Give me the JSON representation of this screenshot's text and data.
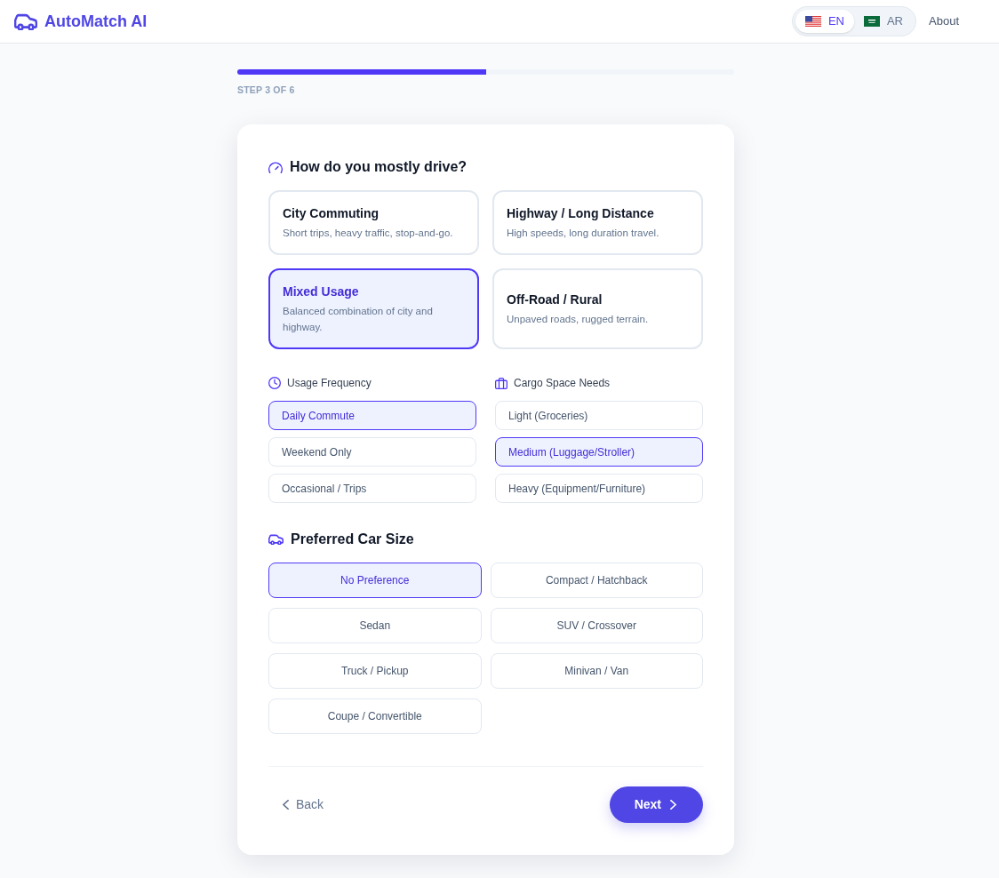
{
  "header": {
    "logo": "AutoMatch AI",
    "languages": [
      {
        "code": "EN",
        "selected": true
      },
      {
        "code": "AR",
        "selected": false
      }
    ],
    "nav": [
      "About"
    ]
  },
  "progress": {
    "level": 0.5,
    "label": "STEP 3 OF 6"
  },
  "driving": {
    "title": "How do you mostly drive?",
    "options": [
      {
        "title": "City Commuting",
        "description": "Short trips, heavy traffic, stop-and-go.",
        "selected": false
      },
      {
        "title": "Highway / Long Distance",
        "description": "High speeds, long duration travel.",
        "selected": false
      },
      {
        "title": "Mixed Usage",
        "description": "Balanced combination of city and highway.",
        "selected": true
      },
      {
        "title": "Off-Road / Rural",
        "description": "Unpaved roads, rugged terrain.",
        "selected": false
      }
    ]
  },
  "usage_frequency": {
    "label": "Usage Frequency",
    "options": [
      {
        "label": "Daily Commute",
        "selected": true
      },
      {
        "label": "Weekend Only",
        "selected": false
      },
      {
        "label": "Occasional / Trips",
        "selected": false
      }
    ]
  },
  "cargo_space": {
    "label": "Cargo Space Needs",
    "options": [
      {
        "label": "Light (Groceries)",
        "selected": false
      },
      {
        "label": "Medium (Luggage/Stroller)",
        "selected": true
      },
      {
        "label": "Heavy (Equipment/Furniture)",
        "selected": false
      }
    ]
  },
  "car_size": {
    "title": "Preferred Car Size",
    "options": [
      {
        "label": "No Preference",
        "selected": true
      },
      {
        "label": "Compact / Hatchback",
        "selected": false
      },
      {
        "label": "Sedan",
        "selected": false
      },
      {
        "label": "SUV / Crossover",
        "selected": false
      },
      {
        "label": "Truck / Pickup",
        "selected": false
      },
      {
        "label": "Minivan / Van",
        "selected": false
      },
      {
        "label": "Coupe / Convertible",
        "selected": false
      }
    ]
  },
  "footer": {
    "back": "Back",
    "next": "Next"
  }
}
